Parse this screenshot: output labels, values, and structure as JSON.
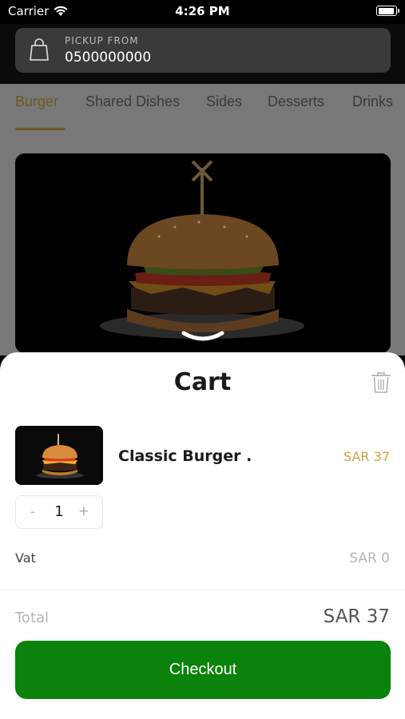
{
  "status_bar": {
    "carrier": "Carrier",
    "time": "4:26 PM"
  },
  "pickup": {
    "label": "PICKUP FROM",
    "phone": "0500000000",
    "icon": "shopping-bag-icon"
  },
  "tabs": [
    {
      "label": "Burger",
      "active": true
    },
    {
      "label": "Shared Dishes",
      "active": false
    },
    {
      "label": "Sides",
      "active": false
    },
    {
      "label": "Desserts",
      "active": false
    },
    {
      "label": "Drinks",
      "active": false
    }
  ],
  "cart": {
    "title": "Cart",
    "items": [
      {
        "name": "Classic Burger .",
        "price": "SAR 37",
        "quantity": "1"
      }
    ],
    "stepper": {
      "minus": "-",
      "plus": "+"
    },
    "vat_label": "Vat",
    "vat_value": "SAR 0",
    "total_label": "Total",
    "total_value": "SAR 37",
    "checkout_label": "Checkout"
  },
  "colors": {
    "accent_gold": "#c9a544",
    "checkout_green": "#0b820b"
  }
}
